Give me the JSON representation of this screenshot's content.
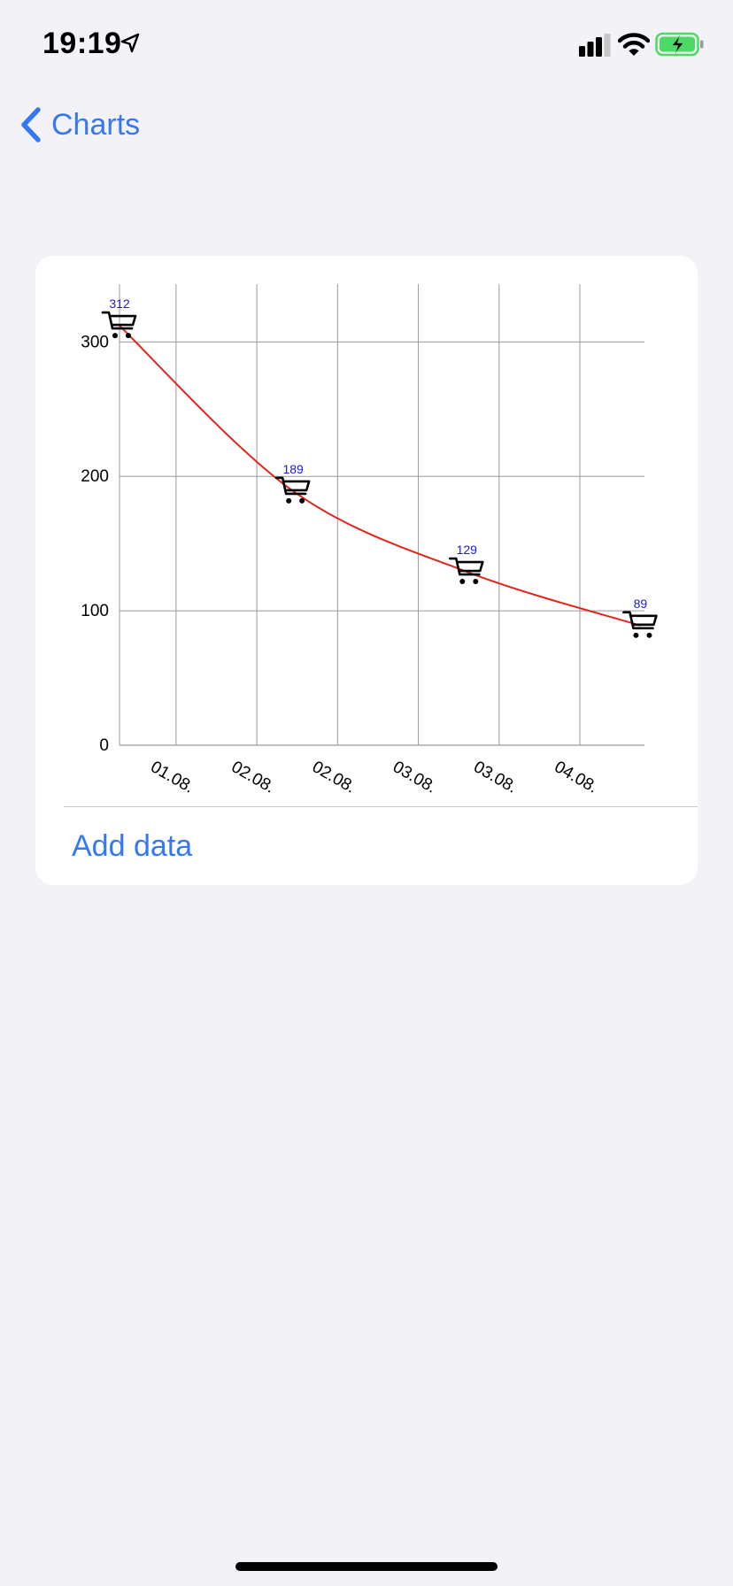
{
  "status_bar": {
    "time": "19:19",
    "icons": [
      "location-arrow-icon",
      "cellular-signal-icon",
      "wifi-icon",
      "battery-charging-icon"
    ]
  },
  "nav": {
    "back_label": "Charts",
    "back_icon": "chevron-left-icon"
  },
  "colors": {
    "accent": "#3478f6",
    "line": "#e0261c",
    "value_label": "#1a1ad6",
    "grid": "#9a9a9a",
    "battery": "#4cd964",
    "background": "#f2f2f7",
    "card": "#ffffff"
  },
  "chart_data": {
    "type": "line",
    "marker_icon": "shopping-cart-icon",
    "line_style": "smooth",
    "x_tick_labels": [
      "01.08.",
      "02.08.",
      "02.08.",
      "03.08.",
      "03.08.",
      "04.08."
    ],
    "y_ticks": [
      0,
      100,
      200,
      300
    ],
    "ylim": [
      0,
      343
    ],
    "xlim": [
      0,
      6.5
    ],
    "grid": true,
    "points": [
      {
        "x": 0.0,
        "y": 312,
        "label": "312"
      },
      {
        "x": 2.15,
        "y": 189,
        "label": "189"
      },
      {
        "x": 4.3,
        "y": 129,
        "label": "129"
      },
      {
        "x": 6.45,
        "y": 89,
        "label": "89"
      }
    ]
  },
  "card": {
    "add_data_label": "Add data"
  }
}
